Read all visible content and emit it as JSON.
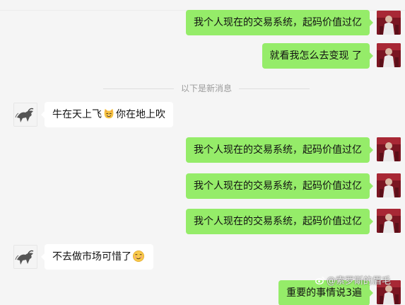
{
  "messages": [
    {
      "side": "self",
      "text": "我个人现在的交易系统，起码价值过亿"
    },
    {
      "side": "self",
      "text": "就看我怎么去变现 了"
    },
    {
      "side": "other",
      "text_before": "牛在天上飞",
      "emoji": "cat-face-icon",
      "text_after": "你在地上吹"
    },
    {
      "side": "self",
      "text": "我个人现在的交易系统，起码价值过亿"
    },
    {
      "side": "self",
      "text": "我个人现在的交易系统，起码价值过亿"
    },
    {
      "side": "self",
      "text": "我个人现在的交易系统，起码价值过亿"
    },
    {
      "side": "other",
      "text_before": "不去做市场可惜了",
      "emoji": "smirk-face-icon"
    },
    {
      "side": "self",
      "text": "重要的事情说3遍"
    }
  ],
  "divider": {
    "label": "以下是新消息"
  },
  "watermark": {
    "text": "@索罗斯的眉毛"
  },
  "colors": {
    "self_bubble": "#95ec69",
    "other_bubble": "#ffffff",
    "background": "#f5f5f5",
    "self_avatar": "#7a1622"
  }
}
